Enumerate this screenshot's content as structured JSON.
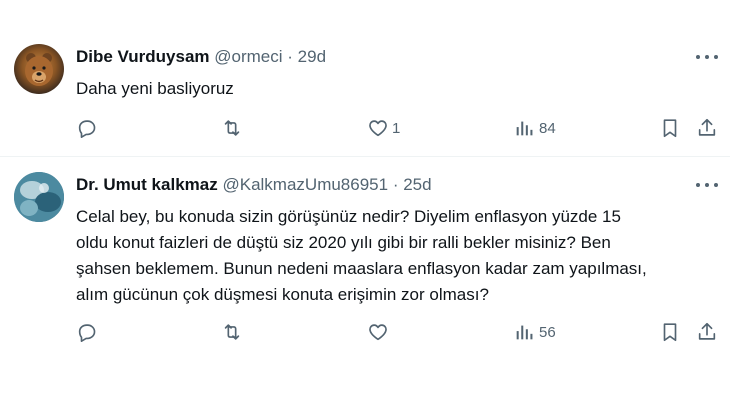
{
  "tweets": [
    {
      "name": "Dibe Vurduysam",
      "handle": "@ormeci",
      "separator": "·",
      "time": "29d",
      "text": "Daha yeni basliyoruz",
      "avatar_icon": "bear-avatar",
      "actions": {
        "reply": "",
        "retweet": "",
        "like": "1",
        "views": "84"
      }
    },
    {
      "name": "Dr. Umut kalkmaz",
      "handle": "@KalkmazUmu86951",
      "separator": "·",
      "time": "25d",
      "text_lines": [
        "Celal bey, bu konuda sizin görüşünüz nedir?  Diyelim enflasyon yüzde 15",
        "oldu konut faizleri de düştü siz 2020 yılı gibi bir ralli bekler misiniz? Ben",
        "şahsen beklemem. Bunun nedeni maaslara enflasyon kadar zam yapılması,",
        "alım gücünun çok düşmesi konuta erişimin zor olması?"
      ],
      "avatar_icon": "user-avatar",
      "actions": {
        "reply": "",
        "retweet": "",
        "like": "",
        "views": "56"
      }
    }
  ],
  "colors": {
    "text": "#0f1419",
    "secondary": "#536471",
    "divider": "#eff3f4"
  }
}
